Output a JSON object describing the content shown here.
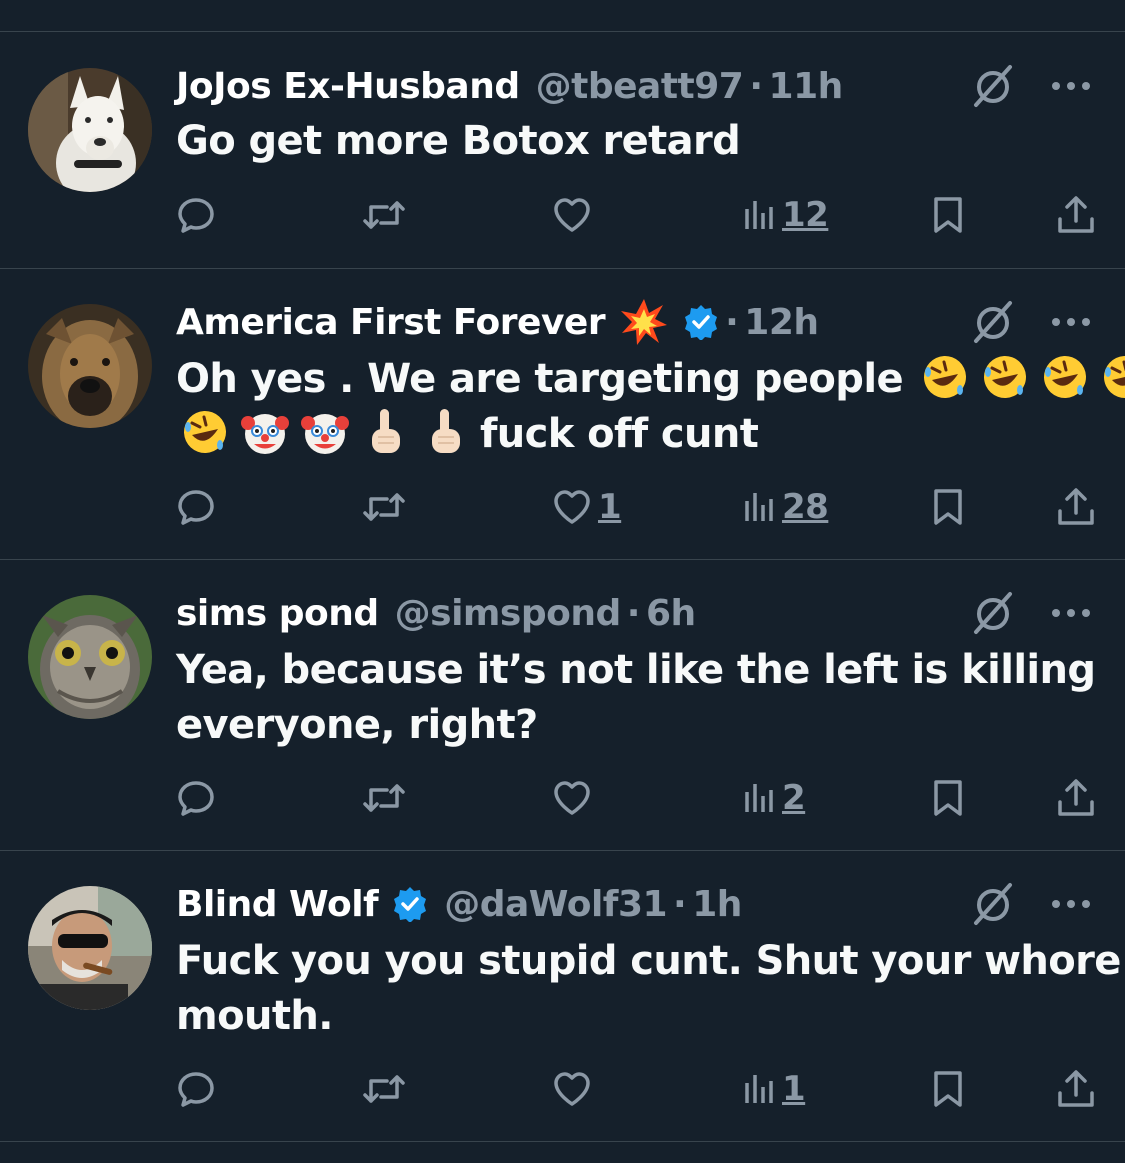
{
  "colors": {
    "background": "#15202b",
    "divider": "#38444d",
    "text": "#f7f9f9",
    "secondary": "#8b98a5",
    "verified": "#1d9bf0"
  },
  "tweets": [
    {
      "name": "JoJos Ex-Husband",
      "handle": "@tbeatt97",
      "separator": "·",
      "time": "11h",
      "verified": false,
      "text": "Go get more Botox retard",
      "likes": "",
      "views": "12",
      "avatar_icon": "white-dog-avatar"
    },
    {
      "name": "America First Forever",
      "name_emoji": "collision-emoji",
      "handle": "",
      "separator": "·",
      "time": "12h",
      "verified": true,
      "text_line1": "Oh yes . We are targeting people",
      "text_line2_suffix": "fuck off cunt",
      "likes": "1",
      "views": "28",
      "avatar_icon": "brown-dog-avatar",
      "emojis": [
        "rofl-emoji",
        "rofl-emoji",
        "rofl-emoji",
        "rofl-emoji",
        "rofl-emoji",
        "clown-emoji",
        "clown-emoji",
        "pointing-up-emoji",
        "pointing-up-emoji"
      ]
    },
    {
      "name": "sims pond",
      "handle": "@simspond",
      "separator": "·",
      "time": "6h",
      "verified": false,
      "text_line1": "Yea, because it’s not like the left is killing",
      "text_line2": "everyone, right?",
      "likes": "",
      "views": "2",
      "avatar_icon": "owl-avatar"
    },
    {
      "name": "Blind Wolf",
      "handle": "@daWolf31",
      "separator": "·",
      "time": "1h",
      "verified": true,
      "text_line1": "Fuck you you stupid cunt. Shut your whore",
      "text_line2": "mouth.",
      "likes": "",
      "views": "1",
      "avatar_icon": "man-with-cigar-avatar"
    }
  ],
  "icons": {
    "reply": "reply-icon",
    "retweet": "retweet-icon",
    "like": "like-icon",
    "views": "views-icon",
    "bookmark": "bookmark-icon",
    "share": "share-icon",
    "grok": "grok-icon",
    "more": "more-icon"
  }
}
